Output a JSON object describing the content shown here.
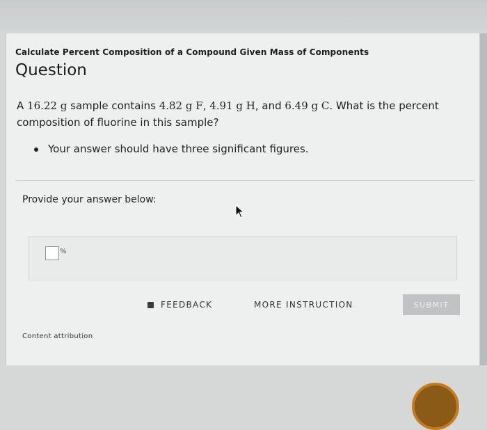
{
  "breadcrumb": "Calculate Percent Composition of a Compound Given Mass of Components",
  "question_heading": "Question",
  "question": {
    "part1": "A ",
    "sample_mass": "16.22",
    "unit_g1": " g",
    "part2": " sample contains ",
    "mass_f": "4.82",
    "unit_f": " g F",
    "comma1": ", ",
    "mass_h": "4.91",
    "unit_h": " g H",
    "part3": ", and ",
    "mass_c": "6.49",
    "unit_c": " g C",
    "part4": ". What is the percent composition of fluorine in this sample?"
  },
  "bullet": "Your answer should have three significant figures.",
  "answer_prompt": "Provide your answer below:",
  "answer": {
    "value": "",
    "unit": "%"
  },
  "buttons": {
    "feedback": "FEEDBACK",
    "more_instruction": "MORE INSTRUCTION",
    "submit": "SUBMIT"
  },
  "footer": {
    "attribution": "Content attribution"
  }
}
